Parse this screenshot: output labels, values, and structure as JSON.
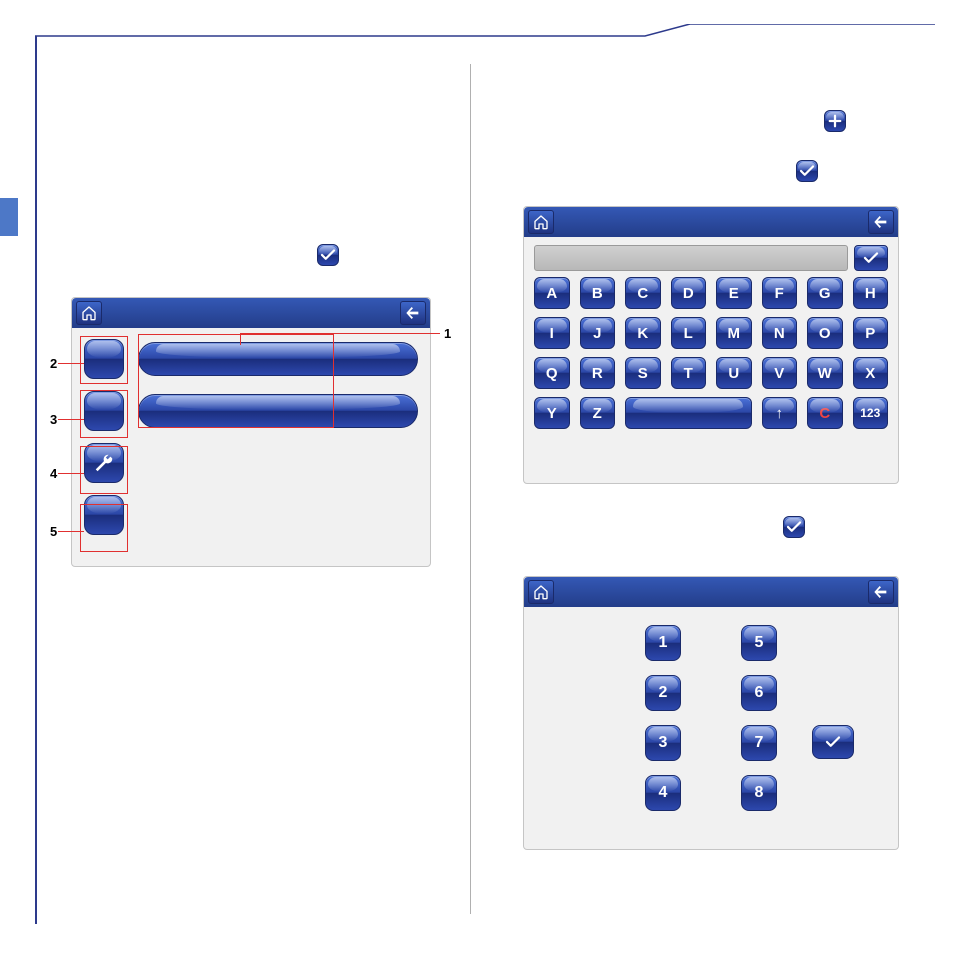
{
  "colors": {
    "brand": "#2d3a8c",
    "button_top": "#4b72d8",
    "button_bottom": "#1a2d7c",
    "highlight": "#e03030"
  },
  "labels": {
    "n1": "1",
    "n2": "2",
    "n3": "3",
    "n4": "4",
    "n5": "5"
  },
  "screenA": {
    "home_icon": "home",
    "back_icon": "back-arrow",
    "items": [
      {
        "icon": "blank",
        "bar": true
      },
      {
        "icon": "blank",
        "bar": true
      },
      {
        "icon": "wrench",
        "bar": false
      },
      {
        "icon": "blank",
        "bar": false
      }
    ]
  },
  "keyboard": {
    "home_icon": "home",
    "back_icon": "back-arrow",
    "input_value": "",
    "ok_icon": "check",
    "keys_row1": [
      "A",
      "B",
      "C",
      "D",
      "E",
      "F",
      "G",
      "H"
    ],
    "keys_row2": [
      "I",
      "J",
      "K",
      "L",
      "M",
      "N",
      "O",
      "P"
    ],
    "keys_row3": [
      "Q",
      "R",
      "S",
      "T",
      "U",
      "V",
      "W",
      "X"
    ],
    "keys_row4_left": [
      "Y",
      "Z"
    ],
    "space_label": "",
    "shift_icon": "↑",
    "clear_label": "C",
    "mode_label": "123"
  },
  "numpad": {
    "home_icon": "home",
    "back_icon": "back-arrow",
    "col1": [
      "1",
      "2",
      "3",
      "4"
    ],
    "col2": [
      "5",
      "6",
      "7",
      "8"
    ],
    "ok_icon": "check"
  },
  "inline_icons": {
    "check1": "check",
    "plus": "plus",
    "check2": "check",
    "check3": "check"
  }
}
